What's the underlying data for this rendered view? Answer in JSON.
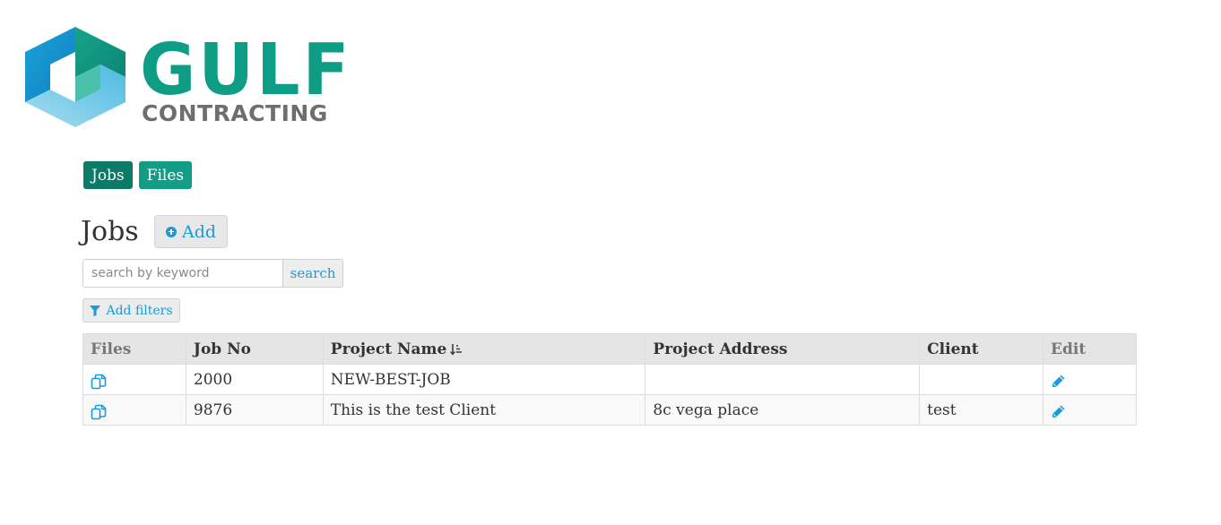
{
  "brand": {
    "name": "GULF",
    "subtitle": "CONTRACTING",
    "primary_color": "#0d9c84",
    "secondary_color": "#6d6e70"
  },
  "nav": {
    "items": [
      {
        "label": "Jobs",
        "active": true
      },
      {
        "label": "Files",
        "active": false
      }
    ]
  },
  "page": {
    "title": "Jobs",
    "add_label": "Add"
  },
  "search": {
    "placeholder": "search by keyword",
    "value": "",
    "button_label": "search"
  },
  "filters": {
    "label": "Add filters"
  },
  "table": {
    "columns": [
      "Files",
      "Job No",
      "Project Name",
      "Project Address",
      "Client",
      "Edit"
    ],
    "sorted_column": "Project Name",
    "rows": [
      {
        "job_no": "2000",
        "project_name": "NEW-BEST-JOB",
        "project_address": "",
        "client": ""
      },
      {
        "job_no": "9876",
        "project_name": "This is the test Client",
        "project_address": "8c vega place",
        "client": "test"
      }
    ]
  },
  "icons": {
    "files": "copy-icon",
    "edit": "pencil-icon",
    "filter": "funnel-icon",
    "add": "plus-circle-icon",
    "sort": "sort-ascending-icon"
  },
  "accent_color": "#1a9ad6"
}
